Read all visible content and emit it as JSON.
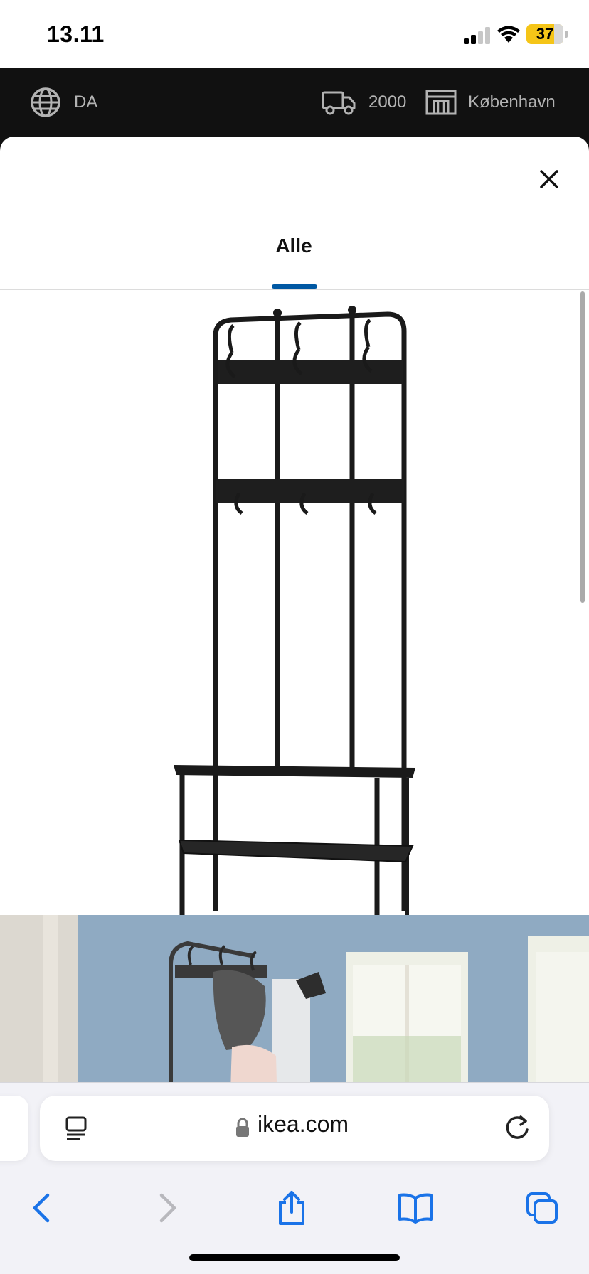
{
  "status_bar": {
    "time": "13.11",
    "battery": "37",
    "signal_icon": "cellular-signal-icon",
    "wifi_icon": "wifi-icon",
    "battery_color": "#f5c518"
  },
  "ikea_header": {
    "language": "DA",
    "postal_code": "2000",
    "store": "København",
    "background": "#111111"
  },
  "modal": {
    "close_icon": "close-icon",
    "tabs": [
      {
        "label": "Alle",
        "active": true
      }
    ],
    "accent_color": "#0058a3",
    "images": [
      {
        "alt": "product-image"
      },
      {
        "alt": "room-photo"
      }
    ]
  },
  "safari": {
    "url": "ikea.com",
    "icons": {
      "reader": "reader-icon",
      "lock": "lock-icon",
      "reload": "reload-icon",
      "back": "back-icon",
      "forward": "forward-icon",
      "share": "share-icon",
      "bookmarks": "bookmarks-icon",
      "tabs": "tabs-icon"
    },
    "accent_color": "#1a73e8"
  }
}
